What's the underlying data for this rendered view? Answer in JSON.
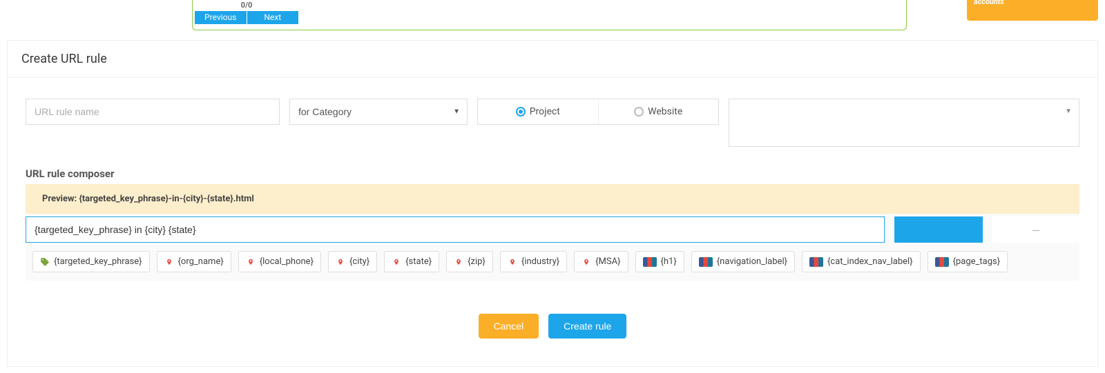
{
  "top": {
    "pager_count": "0/0",
    "prev": "Previous",
    "next": "Next",
    "banner": "accounts"
  },
  "panel": {
    "title": "Create URL rule"
  },
  "form": {
    "name_placeholder": "URL rule name",
    "for_category": "for Category",
    "radio": {
      "project": "Project",
      "website": "Website"
    }
  },
  "composer": {
    "section_title": "URL rule composer",
    "preview_label": "Preview: ",
    "preview_value": "{targeted_key_phrase}-in-{city}-{state}.html",
    "input_value": "{targeted_key_phrase} in {city} {state}",
    "add": " ",
    "minus": "–",
    "tokens": [
      "{targeted_key_phrase}",
      "{org_name}",
      "{local_phone}",
      "{city}",
      "{state}",
      "{zip}",
      "{industry}",
      "{MSA}",
      "{h1}",
      "{navigation_label}",
      "{cat_index_nav_label}",
      "{page_tags}"
    ]
  },
  "footer": {
    "cancel": "Cancel",
    "create": "Create rule"
  }
}
